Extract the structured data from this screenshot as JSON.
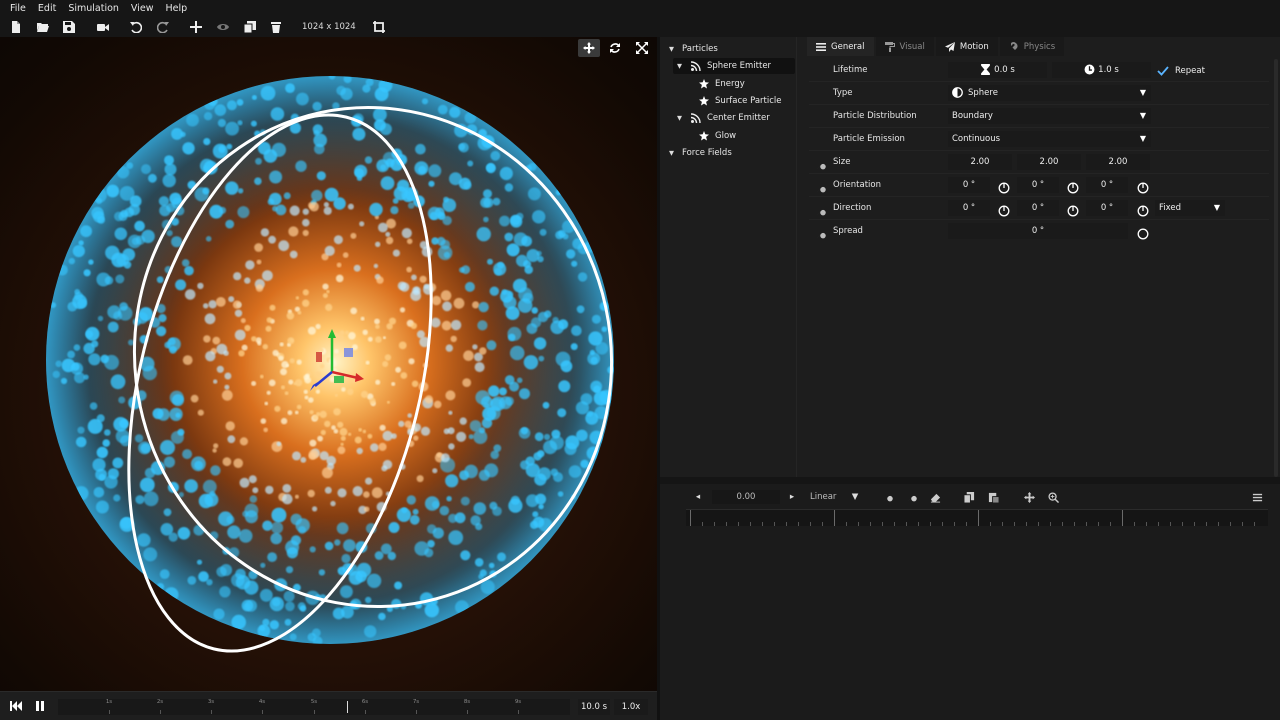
{
  "menu": [
    "File",
    "Edit",
    "Simulation",
    "View",
    "Help"
  ],
  "toolbar": {
    "icons": [
      "new-file-icon",
      "open-folder-icon",
      "save-icon",
      "record-video-icon",
      "undo-icon",
      "redo-icon",
      "add-icon",
      "visibility-icon",
      "duplicate-icon",
      "delete-icon",
      "crop-icon"
    ],
    "resolution": "1024 x 1024"
  },
  "viewport": {
    "tools": [
      "move-icon",
      "refresh-icon",
      "fullscreen-icon"
    ],
    "colors": {
      "particle": "#39c6ff",
      "core": "#ffb24a",
      "background": "#120904",
      "outline": "#ffffff"
    }
  },
  "playback": {
    "ticks": [
      "1s",
      "2s",
      "3s",
      "4s",
      "5s",
      "6s",
      "7s",
      "8s",
      "9s"
    ],
    "duration": "10.0 s",
    "speed": "1.0x"
  },
  "tree": {
    "items": [
      {
        "label": "Particles",
        "kind": "group",
        "expanded": true
      },
      {
        "label": "Sphere Emitter",
        "kind": "emitter",
        "selected": true
      },
      {
        "label": "Energy",
        "kind": "star"
      },
      {
        "label": "Surface Particle",
        "kind": "star"
      },
      {
        "label": "Center Emitter",
        "kind": "emitter"
      },
      {
        "label": "Glow",
        "kind": "star"
      },
      {
        "label": "Force Fields",
        "kind": "group",
        "expanded": true
      }
    ]
  },
  "tabs": [
    {
      "label": "General",
      "active": true
    },
    {
      "label": "Visual",
      "active": false
    },
    {
      "label": "Motion",
      "active": false
    },
    {
      "label": "Physics",
      "active": false
    }
  ],
  "props": {
    "lifetime": {
      "label": "Lifetime",
      "start": "0.0 s",
      "end": "1.0 s",
      "repeat_label": "Repeat"
    },
    "type": {
      "label": "Type",
      "value": "Sphere"
    },
    "distribution": {
      "label": "Particle Distribution",
      "value": "Boundary"
    },
    "emission": {
      "label": "Particle Emission",
      "value": "Continuous"
    },
    "size": {
      "label": "Size",
      "x": "2.00",
      "y": "2.00",
      "z": "2.00"
    },
    "orientation": {
      "label": "Orientation",
      "x": "0 °",
      "y": "0 °",
      "z": "0 °"
    },
    "direction": {
      "label": "Direction",
      "x": "0 °",
      "y": "0 °",
      "z": "0 °",
      "mode": "Fixed"
    },
    "spread": {
      "label": "Spread",
      "value": "0 °"
    }
  },
  "timeline": {
    "time": "0.00",
    "interpolation": "Linear"
  }
}
